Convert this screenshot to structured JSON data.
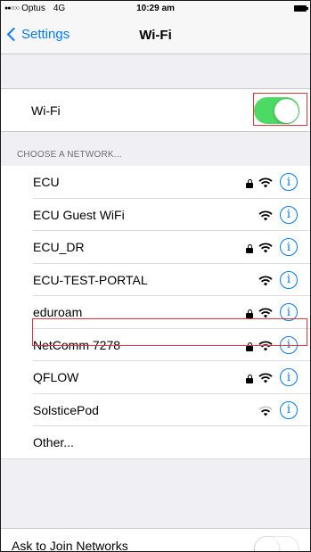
{
  "status_bar": {
    "signal": "●●○○○",
    "carrier": "Optus",
    "network": "4G",
    "time": "10:29 am"
  },
  "nav": {
    "back_label": "Settings",
    "title": "Wi-Fi"
  },
  "wifi": {
    "label": "Wi-Fi",
    "enabled": true
  },
  "section_header": "CHOOSE A NETWORK...",
  "networks": [
    {
      "name": "ECU",
      "locked": true
    },
    {
      "name": "ECU Guest WiFi",
      "locked": false
    },
    {
      "name": "ECU_DR",
      "locked": true
    },
    {
      "name": "ECU-TEST-PORTAL",
      "locked": false
    },
    {
      "name": "eduroam",
      "locked": true,
      "highlighted": true
    },
    {
      "name": "NetComm 7278",
      "locked": true
    },
    {
      "name": "QFLOW",
      "locked": true
    },
    {
      "name": "SolsticePod",
      "locked": false,
      "weak": true
    }
  ],
  "other_label": "Other...",
  "ask_to_join": {
    "label": "Ask to Join Networks",
    "enabled": false
  },
  "colors": {
    "accent": "#007aff",
    "toggle_on": "#4cd964",
    "highlight_box": "#e0343a",
    "group_background": "#efeff4"
  }
}
